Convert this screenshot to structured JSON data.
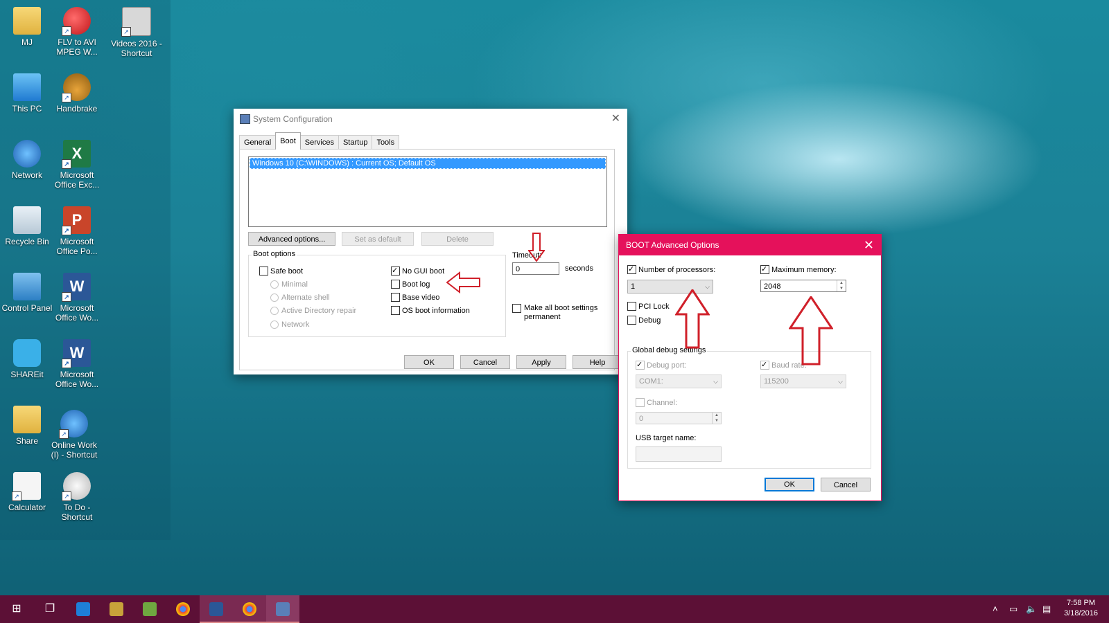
{
  "desktop": {
    "icons": [
      {
        "label": "MJ",
        "icon": "user-folder-icon"
      },
      {
        "label": "FLV to AVI MPEG W...",
        "icon": "video-converter-icon"
      },
      {
        "label": "Videos 2016 - Shortcut",
        "icon": "camera-folder-icon"
      },
      {
        "label": "This PC",
        "icon": "computer-icon"
      },
      {
        "label": "Handbrake",
        "icon": "pineapple-icon"
      },
      {
        "label": "Network",
        "icon": "network-icon"
      },
      {
        "label": "Microsoft Office Exc...",
        "icon": "excel-icon"
      },
      {
        "label": "Recycle Bin",
        "icon": "recycle-bin-icon"
      },
      {
        "label": "Microsoft Office Po...",
        "icon": "powerpoint-icon"
      },
      {
        "label": "Control Panel",
        "icon": "control-panel-icon"
      },
      {
        "label": "Microsoft Office Wo...",
        "icon": "word-icon"
      },
      {
        "label": "SHAREit",
        "icon": "shareit-icon"
      },
      {
        "label": "Microsoft Office Wo...",
        "icon": "word-icon"
      },
      {
        "label": "Share",
        "icon": "folder-icon"
      },
      {
        "label": "Online Work (I) - Shortcut",
        "icon": "online-work-icon"
      },
      {
        "label": "Calculator",
        "icon": "document-icon"
      },
      {
        "label": "To Do - Shortcut",
        "icon": "disc-icon"
      }
    ]
  },
  "sysconfig": {
    "title": "System Configuration",
    "tabs": [
      "General",
      "Boot",
      "Services",
      "Startup",
      "Tools"
    ],
    "active_tab": "Boot",
    "os_entry": "Windows 10 (C:\\WINDOWS) : Current OS; Default OS",
    "buttons": {
      "advanced": "Advanced options...",
      "set_default": "Set as default",
      "delete": "Delete",
      "ok": "OK",
      "cancel": "Cancel",
      "apply": "Apply",
      "help": "Help"
    },
    "boot_options": {
      "label": "Boot options",
      "safe_boot": {
        "label": "Safe boot",
        "checked": false
      },
      "radios": [
        "Minimal",
        "Alternate shell",
        "Active Directory repair",
        "Network"
      ],
      "no_gui_boot": {
        "label": "No GUI boot",
        "checked": true
      },
      "boot_log": {
        "label": "Boot log",
        "checked": false
      },
      "base_video": {
        "label": "Base video",
        "checked": false
      },
      "os_boot_info": {
        "label": "OS boot information",
        "checked": false
      }
    },
    "timeout": {
      "label": "Timeout:",
      "value": "0",
      "unit": "seconds"
    },
    "make_permanent": {
      "label": "Make all boot settings permanent",
      "checked": false
    }
  },
  "advanced": {
    "title": "BOOT Advanced Options",
    "num_processors": {
      "label": "Number of processors:",
      "checked": true,
      "value": "1"
    },
    "max_memory": {
      "label": "Maximum memory:",
      "checked": true,
      "value": "2048"
    },
    "pci_lock": {
      "label": "PCI Lock",
      "checked": false
    },
    "debug": {
      "label": "Debug",
      "checked": false
    },
    "global_debug": {
      "label": "Global debug settings",
      "debug_port": {
        "label": "Debug port:",
        "checked": true,
        "value": "COM1:"
      },
      "baud_rate": {
        "label": "Baud rate:",
        "checked": true,
        "value": "115200"
      },
      "channel": {
        "label": "Channel:",
        "checked": false,
        "value": "0"
      },
      "usb_target": {
        "label": "USB target name:",
        "value": ""
      }
    },
    "buttons": {
      "ok": "OK",
      "cancel": "Cancel"
    }
  },
  "taskbar": {
    "items": [
      "start-icon",
      "task-view-icon",
      "edge-icon",
      "winrar-icon",
      "umatrix-icon",
      "chrome-icon",
      "word-icon",
      "chrome-icon",
      "system-configuration-icon"
    ],
    "clock": {
      "time": "7:58 PM",
      "date": "3/18/2016"
    }
  },
  "colors": {
    "accent_pink": "#e5115b",
    "taskbar": "#5c1036",
    "selection": "#3399ff",
    "annotation_red": "#d0202a"
  }
}
